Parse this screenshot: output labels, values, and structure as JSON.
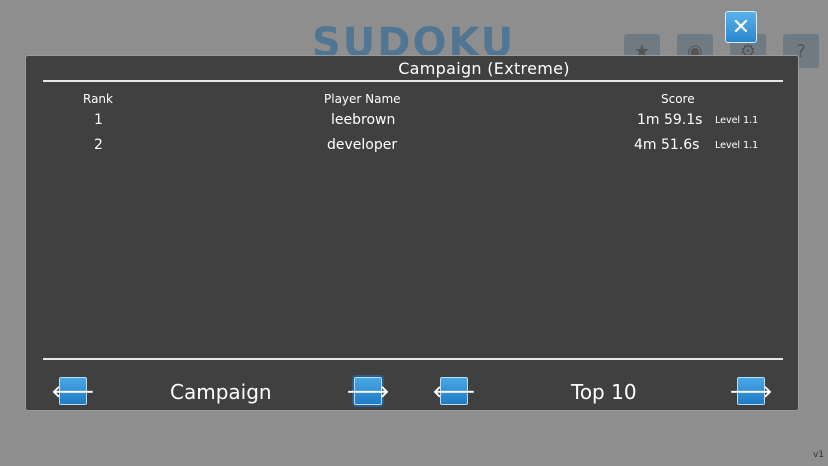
{
  "background": {
    "title": "SUDOKU",
    "version": "v1"
  },
  "dialog": {
    "title": "Campaign  (Extreme)",
    "columns": {
      "rank": "Rank",
      "player": "Player Name",
      "score": "Score"
    },
    "rows": [
      {
        "rank": "1",
        "player": "leebrown",
        "score": "1m 59.1s",
        "level": "Level 1.1"
      },
      {
        "rank": "2",
        "player": "developer",
        "score": "4m 51.6s",
        "level": "Level 1.1"
      }
    ],
    "mode_label": "Campaign",
    "filter_label": "Top 10"
  },
  "icons": {
    "close": "close-icon",
    "prev": "arrow-left-icon",
    "next": "arrow-right-icon"
  },
  "colors": {
    "dialog_bg": "#404040",
    "button_blue": "#2a87cd",
    "overlay": "#8e8e8e"
  }
}
